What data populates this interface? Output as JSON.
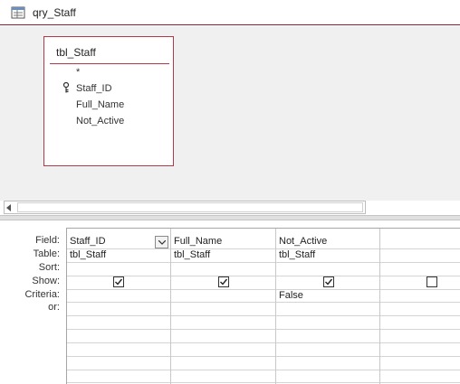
{
  "window": {
    "title": "qry_Staff",
    "icon": "query-icon"
  },
  "table_box": {
    "name": "tbl_Staff",
    "fields": [
      {
        "label": "*",
        "primary_key": false
      },
      {
        "label": "Staff_ID",
        "primary_key": true
      },
      {
        "label": "Full_Name",
        "primary_key": false
      },
      {
        "label": "Not_Active",
        "primary_key": false
      }
    ]
  },
  "grid": {
    "row_labels": [
      "Field:",
      "Table:",
      "Sort:",
      "Show:",
      "Criteria:",
      "or:"
    ],
    "columns": [
      {
        "field": "Staff_ID",
        "table": "tbl_Staff",
        "sort": "",
        "show": true,
        "criteria": "",
        "or": ""
      },
      {
        "field": "Full_Name",
        "table": "tbl_Staff",
        "sort": "",
        "show": true,
        "criteria": "",
        "or": ""
      },
      {
        "field": "Not_Active",
        "table": "tbl_Staff",
        "sort": "",
        "show": true,
        "criteria": "False",
        "or": ""
      },
      {
        "field": "",
        "table": "",
        "sort": "",
        "show": false,
        "criteria": "",
        "or": ""
      }
    ]
  },
  "colors": {
    "accent": "#8b1c2c",
    "pane_bg": "#f0f0f0"
  }
}
